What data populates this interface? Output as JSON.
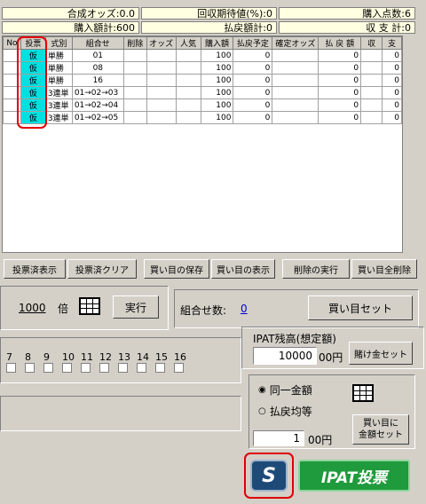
{
  "summary": {
    "odds": "合成オッズ:0.0",
    "recovery": "回収期待値(%):0",
    "count": "購入点数:6",
    "total_buy": "購入額計:600",
    "total_refund": "払戻額計:0",
    "balance": "収 支 計:0"
  },
  "table": {
    "headers": [
      "No",
      "投票",
      "式別",
      "組合せ",
      "削除",
      "オッズ",
      "人気",
      "購入額",
      "払戻予定",
      "確定オッズ",
      "払 戻 額",
      "収",
      "支"
    ],
    "rows": [
      {
        "tohyo": "仮",
        "shiki": "単勝",
        "kumi": "01",
        "buy": "100",
        "refund": "0",
        "pay": "0",
        "bal": "0"
      },
      {
        "tohyo": "仮",
        "shiki": "単勝",
        "kumi": "08",
        "buy": "100",
        "refund": "0",
        "pay": "0",
        "bal": "0"
      },
      {
        "tohyo": "仮",
        "shiki": "単勝",
        "kumi": "16",
        "buy": "100",
        "refund": "0",
        "pay": "0",
        "bal": "0"
      },
      {
        "tohyo": "仮",
        "shiki": "3連単",
        "kumi": "01→02→03",
        "buy": "100",
        "refund": "0",
        "pay": "0",
        "bal": "0"
      },
      {
        "tohyo": "仮",
        "shiki": "3連単",
        "kumi": "01→02→04",
        "buy": "100",
        "refund": "0",
        "pay": "0",
        "bal": "0"
      },
      {
        "tohyo": "仮",
        "shiki": "3連単",
        "kumi": "01→02→05",
        "buy": "100",
        "refund": "0",
        "pay": "0",
        "bal": "0"
      }
    ]
  },
  "buttons_row": {
    "voted_show": "投票済表示",
    "voted_clear": "投票済クリア",
    "save": "買い目の保存",
    "show": "買い目の表示",
    "delete_exec": "削除の実行",
    "delete_all": "買い目全削除"
  },
  "multiplier": {
    "value": "1000",
    "unit": "倍",
    "exec": "実行"
  },
  "combo": {
    "label": "組合せ数:",
    "value": "0",
    "set_button": "買い目セット"
  },
  "horse_numbers": [
    "7",
    "8",
    "9",
    "10",
    "11",
    "12",
    "13",
    "14",
    "15",
    "16"
  ],
  "ipat": {
    "balance_label": "IPAT残高(想定額)",
    "balance_value": "10000",
    "yen": "00円",
    "bet_set": "賭け金セット",
    "option_same": "同一金額",
    "option_equal": "払戻均等",
    "amount_value": "1",
    "amount_unit": "00円",
    "to_amount_line1": "買い目に",
    "to_amount_line2": "金額セット",
    "s_button": "S",
    "vote_button": "IPAT投票"
  },
  "colors": {
    "tohyo_cell": "#00e0e0",
    "highlight": "#e00000",
    "ipat_green": "#1f9a3c",
    "s_blue": "#1e4a78"
  }
}
